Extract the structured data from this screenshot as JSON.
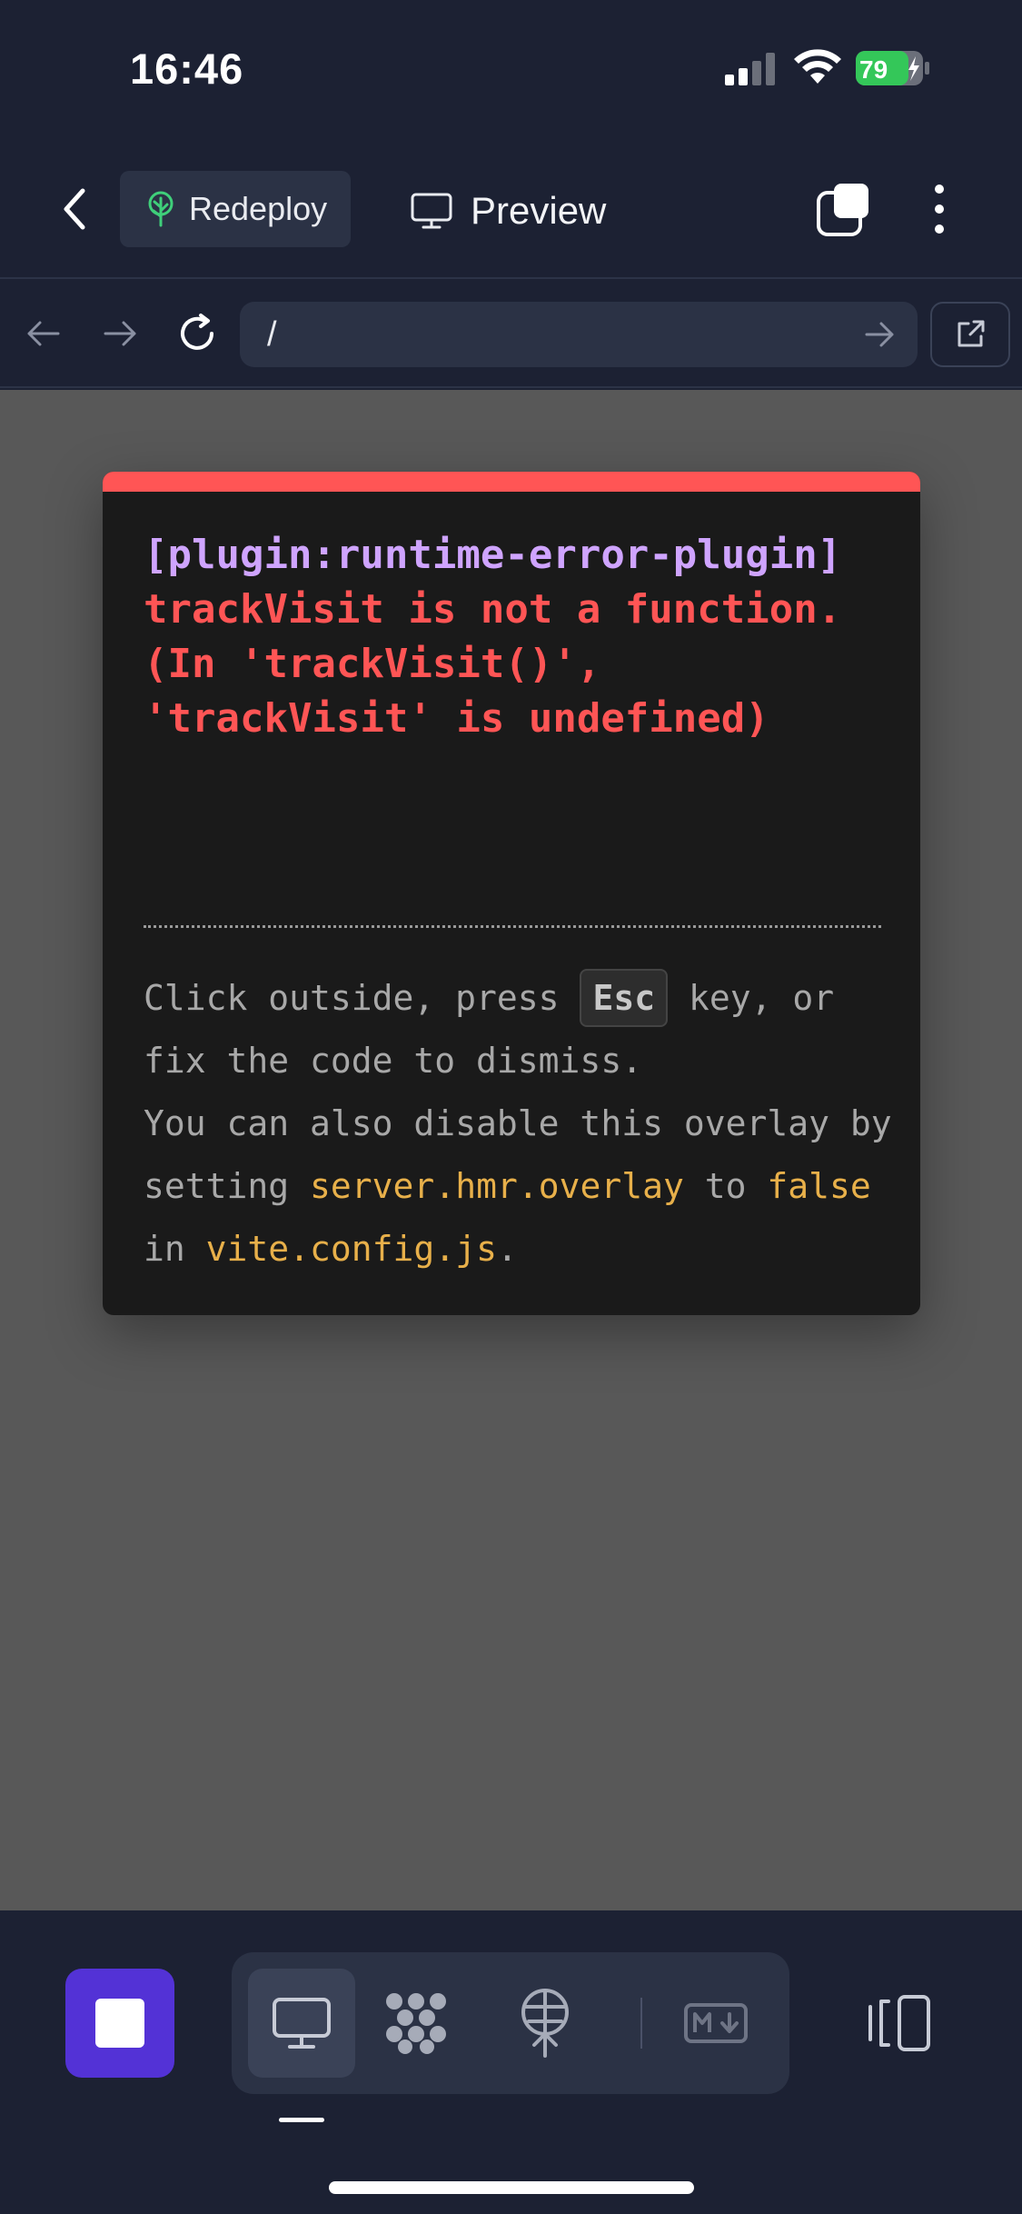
{
  "status_bar": {
    "time": "16:46",
    "battery": "79"
  },
  "header": {
    "redeploy_label": "Redeploy",
    "preview_label": "Preview"
  },
  "url_bar": {
    "url": "/"
  },
  "error_overlay": {
    "plugin_tag": "[plugin:runtime-error-plugin]",
    "message": "trackVisit is not a function. (In 'trackVisit()', 'trackVisit' is undefined)",
    "tip_part1": "Click outside, press",
    "tip_key": "Esc",
    "tip_part2": "key, or fix the code to dismiss.",
    "tip_part3": "You can also disable this overlay by setting",
    "tip_code1": "server.hmr.overlay",
    "tip_part4": "to",
    "tip_code2": "false",
    "tip_part5": "in",
    "tip_code3": "vite.config.js",
    "tip_part6": "."
  },
  "colors": {
    "accent": "#5332d6",
    "error": "#ff5555",
    "plugin": "#cfa4ff",
    "code": "#e8b04a"
  },
  "toolbar": {
    "tabs": [
      "desktop-preview-icon",
      "dependencies-icon",
      "deploy-icon",
      "markdown-icon"
    ]
  }
}
